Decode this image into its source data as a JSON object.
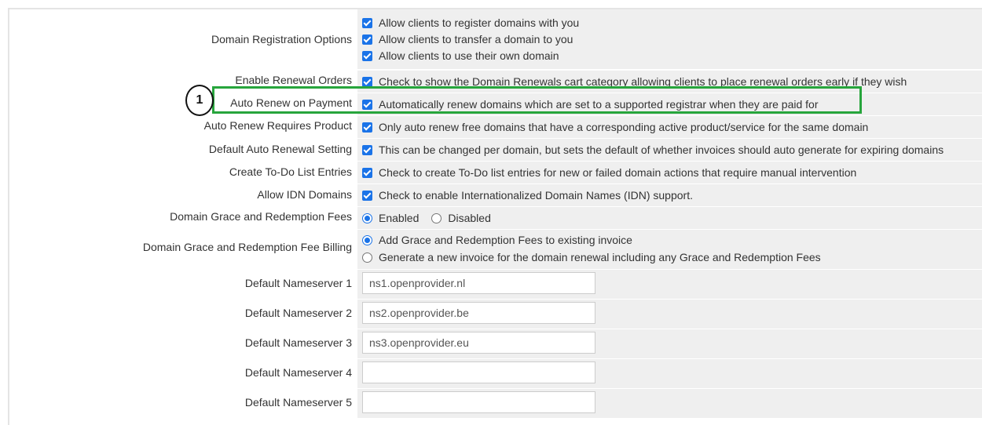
{
  "settings": {
    "domain_registration_options": {
      "label": "Domain Registration Options",
      "options": [
        "Allow clients to register domains with you",
        "Allow clients to transfer a domain to you",
        "Allow clients to use their own domain"
      ]
    },
    "enable_renewal_orders": {
      "label": "Enable Renewal Orders",
      "text": "Check to show the Domain Renewals cart category allowing clients to place renewal orders early if they wish"
    },
    "auto_renew_on_payment": {
      "label": "Auto Renew on Payment",
      "text": "Automatically renew domains which are set to a supported registrar when they are paid for"
    },
    "auto_renew_requires_product": {
      "label": "Auto Renew Requires Product",
      "text": "Only auto renew free domains that have a corresponding active product/service for the same domain"
    },
    "default_auto_renewal_setting": {
      "label": "Default Auto Renewal Setting",
      "text": "This can be changed per domain, but sets the default of whether invoices should auto generate for expiring domains"
    },
    "create_todo_entries": {
      "label": "Create To-Do List Entries",
      "text": "Check to create To-Do list entries for new or failed domain actions that require manual intervention"
    },
    "allow_idn_domains": {
      "label": "Allow IDN Domains",
      "text": "Check to enable Internationalized Domain Names (IDN) support."
    },
    "grace_redemption_fees": {
      "label": "Domain Grace and Redemption Fees",
      "options": [
        "Enabled",
        "Disabled"
      ],
      "selected": "Enabled"
    },
    "grace_redemption_billing": {
      "label": "Domain Grace and Redemption Fee Billing",
      "options": [
        "Add Grace and Redemption Fees to existing invoice",
        "Generate a new invoice for the domain renewal including any Grace and Redemption Fees"
      ],
      "selected": "Add Grace and Redemption Fees to existing invoice"
    },
    "nameservers": [
      {
        "label": "Default Nameserver 1",
        "value": "ns1.openprovider.nl"
      },
      {
        "label": "Default Nameserver 2",
        "value": "ns2.openprovider.be"
      },
      {
        "label": "Default Nameserver 3",
        "value": "ns3.openprovider.eu"
      },
      {
        "label": "Default Nameserver 4",
        "value": ""
      },
      {
        "label": "Default Nameserver 5",
        "value": ""
      }
    ]
  },
  "annotation": {
    "step_number": "1",
    "highlight_color": "#27a53c"
  },
  "colors": {
    "checkbox": "#1a73e8",
    "value_bg": "#efefef"
  }
}
